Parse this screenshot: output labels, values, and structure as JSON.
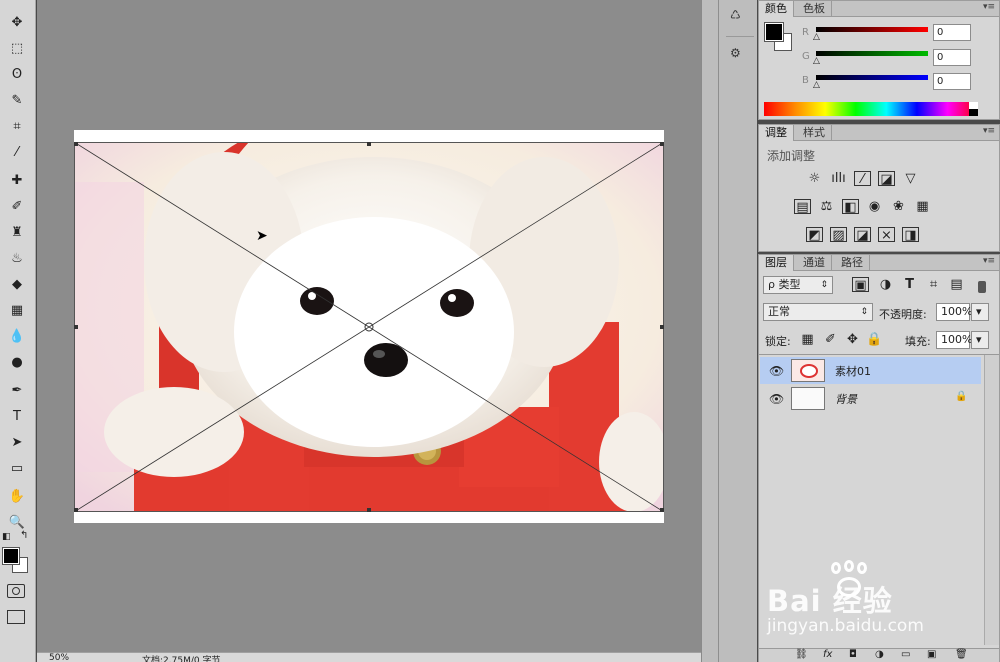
{
  "toolbar": {
    "tools": [
      {
        "name": "move-tool-icon",
        "glyph": "✥"
      },
      {
        "name": "marquee-tool-icon",
        "glyph": "⬚"
      },
      {
        "name": "lasso-tool-icon",
        "glyph": "ʘ"
      },
      {
        "name": "quick-select-tool-icon",
        "glyph": "✎"
      },
      {
        "name": "crop-tool-icon",
        "glyph": "⌗"
      },
      {
        "name": "eyedropper-tool-icon",
        "glyph": "⁄"
      },
      {
        "name": "healing-brush-tool-icon",
        "glyph": "✚"
      },
      {
        "name": "brush-tool-icon",
        "glyph": "✐"
      },
      {
        "name": "clone-stamp-tool-icon",
        "glyph": "♜"
      },
      {
        "name": "history-brush-tool-icon",
        "glyph": "♨"
      },
      {
        "name": "eraser-tool-icon",
        "glyph": "◆"
      },
      {
        "name": "gradient-tool-icon",
        "glyph": "▦"
      },
      {
        "name": "blur-tool-icon",
        "glyph": "💧"
      },
      {
        "name": "dodge-tool-icon",
        "glyph": "●"
      },
      {
        "name": "pen-tool-icon",
        "glyph": "✒"
      },
      {
        "name": "type-tool-icon",
        "glyph": "T"
      },
      {
        "name": "path-select-tool-icon",
        "glyph": "➤"
      },
      {
        "name": "shape-tool-icon",
        "glyph": "▭"
      },
      {
        "name": "hand-tool-icon",
        "glyph": "✋"
      },
      {
        "name": "zoom-tool-icon",
        "glyph": "🔍"
      }
    ]
  },
  "status": {
    "zoom": "50%",
    "doc_info": "文档:2.75M/0 字节"
  },
  "color_panel": {
    "tabs": [
      "颜色",
      "色板"
    ],
    "channels": [
      {
        "label": "R",
        "value": "0"
      },
      {
        "label": "G",
        "value": "0"
      },
      {
        "label": "B",
        "value": "0"
      }
    ]
  },
  "adjust_panel": {
    "tabs": [
      "调整",
      "样式"
    ],
    "title": "添加调整"
  },
  "layers_panel": {
    "tabs": [
      "图层",
      "通道",
      "路径"
    ],
    "filter_label": "ρ 类型",
    "blend_mode": "正常",
    "opacity_label": "不透明度:",
    "opacity_value": "100%",
    "lock_label": "锁定:",
    "fill_label": "填充:",
    "fill_value": "100%",
    "layers": [
      {
        "name": "素材01",
        "selected": true
      },
      {
        "name": "背景",
        "selected": false
      }
    ]
  },
  "watermark": {
    "brand": "Bai 经验",
    "url": "jingyan.baidu.com"
  }
}
